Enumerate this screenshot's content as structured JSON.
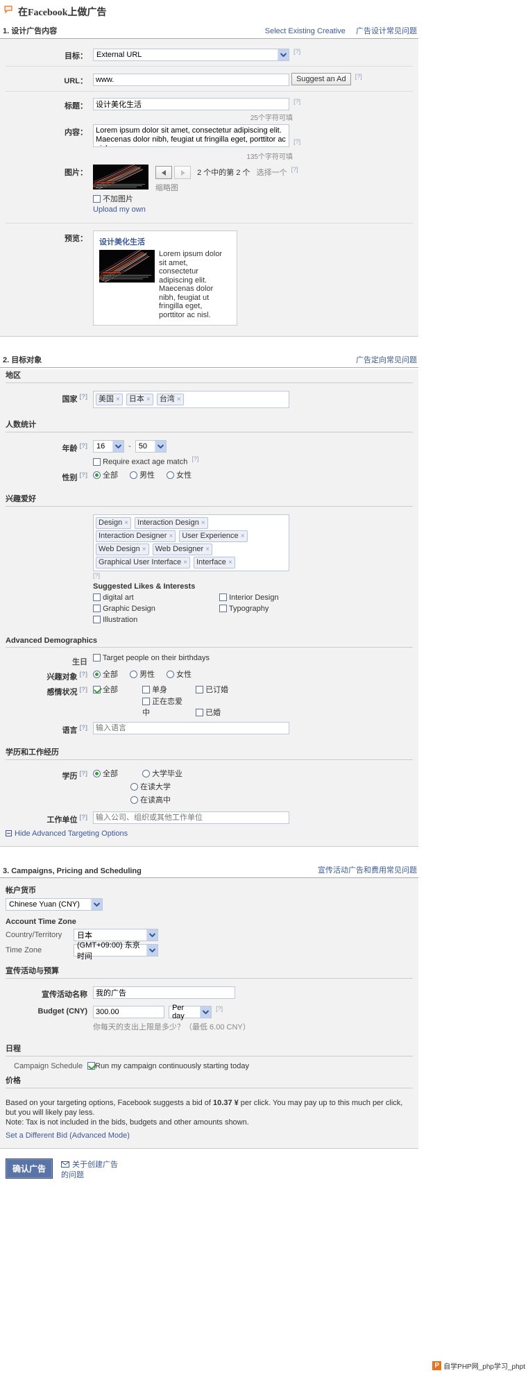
{
  "page": {
    "title": "在Facebook上做广告"
  },
  "section1": {
    "heading": "1. 设计广告内容",
    "link_select_existing": "Select Existing Creative",
    "link_faq": "广告设计常见问题",
    "destination_label": "目标：",
    "destination_value": "External URL",
    "url_label": "URL：",
    "url_value": "www.",
    "suggest_button": "Suggest an Ad",
    "title_label": "标题：",
    "title_value": "设计美化生活",
    "title_counter": "25个字符可填",
    "body_label": "内容：",
    "body_value": "Lorem ipsum dolor sit amet, consectetur adipiscing elit. Maecenas dolor nibh, feugiat ut fringilla eget, porttitor ac nisl.",
    "body_counter": "135个字符可填",
    "image_label": "图片：",
    "image_counter": "2 个中的第 2 个",
    "image_choose": "选择一个",
    "thumbnail_label": "缩略图",
    "no_image_label": "不加图片",
    "upload_link": "Upload my own",
    "preview_label": "预览：",
    "preview_title": "设计美化生活",
    "preview_body": "Lorem ipsum dolor sit amet, consectetur adipiscing elit. Maecenas dolor nibh, feugiat ut fringilla eget, porttitor ac nisl."
  },
  "section2": {
    "heading": "2. 目标对象",
    "link_faq": "广告定向常见问题",
    "location_sub": "地区",
    "country_label": "国家",
    "countries": [
      "美国",
      "日本",
      "台湾"
    ],
    "demo_sub": "人数统计",
    "age_label": "年龄",
    "age_min": "16",
    "age_dash": "-",
    "age_max": "50",
    "exact_age_label": "Require exact age match",
    "gender_label": "性别",
    "gender_options": [
      "全部",
      "男性",
      "女性"
    ],
    "gender_selected": 0,
    "interest_sub": "兴趣爱好",
    "interest_tokens": [
      "Design",
      "Interaction Design",
      "Interaction Designer",
      "User Experience",
      "Web Design",
      "Web Designer",
      "Graphical User Interface",
      "Interface"
    ],
    "suggested_title": "Suggested Likes & Interests",
    "suggested_left": [
      "digital art",
      "Graphic Design",
      "Illustration"
    ],
    "suggested_right": [
      "Interior Design",
      "Typography"
    ],
    "advanced_sub": "Advanced Demographics",
    "birthday_label": "生日",
    "birthday_option": "Target people on their birthdays",
    "interested_in_label": "兴趣对象",
    "interested_in_options": [
      "全部",
      "男性",
      "女性"
    ],
    "interested_in_selected": 0,
    "relationship_label": "感情状况",
    "relationship_row1": [
      "全部",
      "单身",
      "已订婚"
    ],
    "relationship_row2": [
      "正在恋爱中",
      "已婚"
    ],
    "relationship_checked": "全部",
    "language_label": "语言",
    "language_placeholder": "输入语言",
    "edu_sub": "学历和工作经历",
    "edu_label": "学历",
    "edu_options": [
      "全部",
      "大学毕业",
      "在读大学",
      "在读高中"
    ],
    "edu_selected": 0,
    "workplace_label": "工作单位",
    "workplace_placeholder": "输入公司、组织或其他工作单位",
    "hide_advanced": "Hide Advanced Targeting Options"
  },
  "section3": {
    "heading": "3. Campaigns, Pricing and Scheduling",
    "link_faq": "宣传活动广告和费用常见问题",
    "currency_sub": "帐户货币",
    "currency_value": "Chinese Yuan (CNY)",
    "timezone_sub": "Account Time Zone",
    "country_label": "Country/Territory",
    "country_value": "日本",
    "timezone_label": "Time Zone",
    "timezone_value": "(GMT+09:00) 东京时间",
    "campaign_sub": "宣传活动与预算",
    "campaign_name_label": "宣传活动名称",
    "campaign_name_value": "我的广告",
    "budget_label": "Budget (CNY)",
    "budget_value": "300.00",
    "budget_period": "Per day",
    "budget_hint": "你每天的支出上限是多少？（最低 6.00 CNY）",
    "schedule_sub": "日程",
    "schedule_label": "Campaign Schedule",
    "schedule_option": "Run my campaign continuously starting today",
    "price_sub": "价格",
    "price_line1_a": "Based on your targeting options, Facebook suggests a bid of ",
    "price_bid": "10.37 ¥",
    "price_line1_b": " per click. You may pay up to this much per click, but you will likely pay less.",
    "price_line2": "Note: Tax is not included in the bids, budgets and other amounts shown.",
    "price_link": "Set a Different Bid (Advanced Mode)"
  },
  "footer": {
    "confirm_button": "确认广告",
    "help_link": "关于创建广告的问题"
  },
  "watermark": {
    "badge_letter": "P",
    "text": "自学PHP网_php学习_phpt"
  },
  "colors": {
    "link": "#3b5998",
    "button": "#5b74a8",
    "section_bg": "#f2f2f2",
    "border": "#bdc7d8"
  }
}
